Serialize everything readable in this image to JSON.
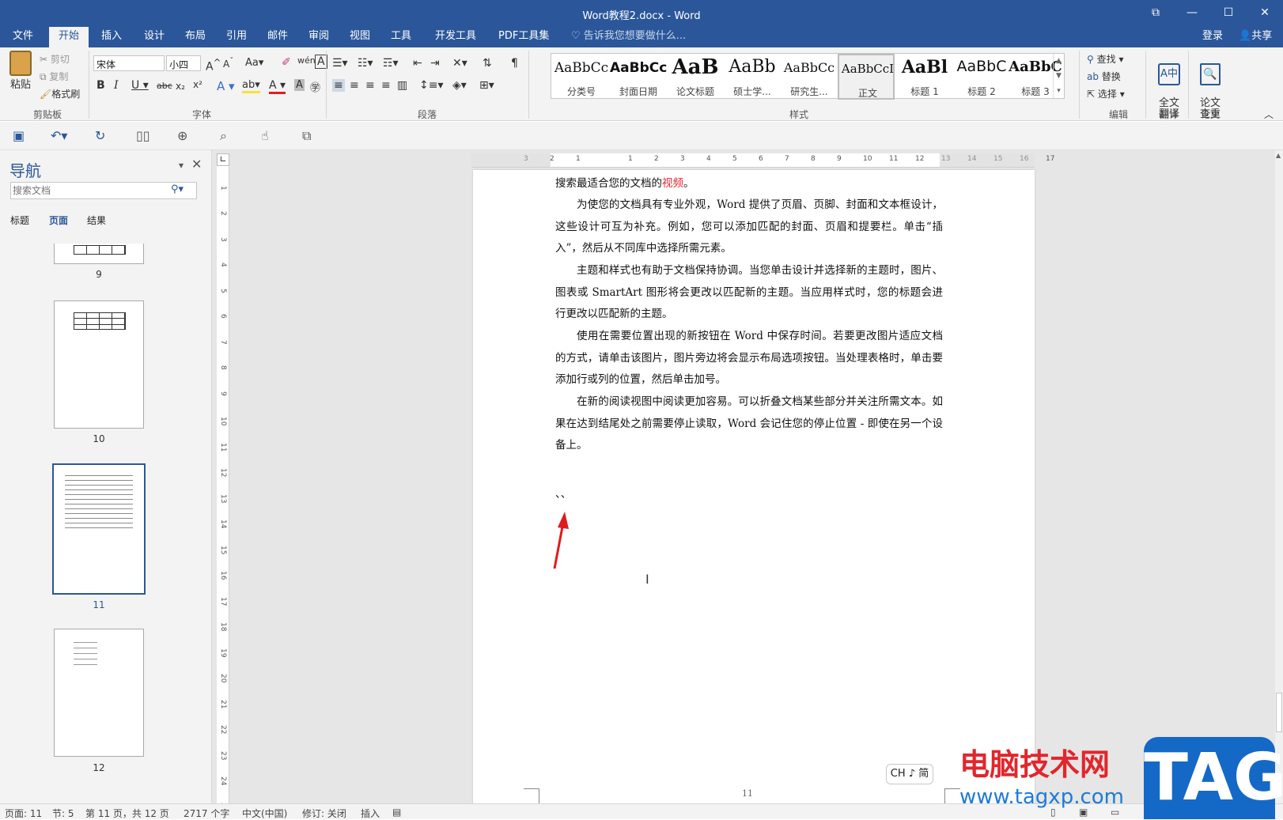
{
  "window": {
    "title": "Word教程2.docx - Word",
    "controls": [
      "⧉",
      "—",
      "☐",
      "✕"
    ]
  },
  "tabs": [
    "文件",
    "开始",
    "插入",
    "设计",
    "布局",
    "引用",
    "邮件",
    "审阅",
    "视图",
    "工具",
    "开发工具",
    "PDF工具集"
  ],
  "active_tab": "开始",
  "tell_me": "告诉我您想要做什么...",
  "account": {
    "login": "登录",
    "share": "共享"
  },
  "ribbon": {
    "clipboard": {
      "paste": "粘贴",
      "cut": "剪切",
      "copy": "复制",
      "format_painter": "格式刷",
      "label": "剪贴板"
    },
    "font": {
      "name": "宋体",
      "size": "小四",
      "label": "字体"
    },
    "paragraph": {
      "label": "段落"
    },
    "styles": {
      "label": "样式",
      "items": [
        {
          "preview": "AaBbCc",
          "name": "分类号"
        },
        {
          "preview": "AaBbCc",
          "name": "封面日期"
        },
        {
          "preview": "AaB",
          "name": "论文标题"
        },
        {
          "preview": "AaBb",
          "name": "硕士学..."
        },
        {
          "preview": "AaBbCc",
          "name": "研究生..."
        },
        {
          "preview": "AaBbCcI",
          "name": "正文"
        },
        {
          "preview": "AaBl",
          "name": "标题 1"
        },
        {
          "preview": "AaBbC",
          "name": "标题 2"
        },
        {
          "preview": "AaBbC",
          "name": "标题 3"
        }
      ],
      "selected": "正文"
    },
    "editing": {
      "find": "查找",
      "replace": "替换",
      "select": "选择",
      "label": "编辑"
    },
    "translate": {
      "full": "全文\n翻译",
      "label": "翻译"
    },
    "paper": {
      "check": "论文\n查重",
      "label": "论文"
    }
  },
  "nav": {
    "title": "导航",
    "search_placeholder": "搜索文档",
    "tabs": [
      "标题",
      "页面",
      "结果"
    ],
    "active_tab": "页面",
    "pages": [
      "9",
      "10",
      "11",
      "12"
    ],
    "selected_page": "11"
  },
  "ruler": {
    "h_ticks": [
      "3",
      "2",
      "1",
      "1",
      "2",
      "3",
      "4",
      "5",
      "6",
      "7",
      "8",
      "9",
      "10",
      "11",
      "12",
      "13",
      "14",
      "15",
      "16",
      "17"
    ]
  },
  "document": {
    "paragraphs": [
      {
        "text": "搜索最适合您的文档的",
        "highlight": "视频",
        "after": "。"
      },
      {
        "text": "为使您的文档具有专业外观，Word 提供了页眉、页脚、封面和文本框设计，这些设计可互为补充。例如，您可以添加匹配的封面、页眉和提要栏。单击“插入”，然后从不同库中选择所需元素。"
      },
      {
        "text": "主题和样式也有助于文档保持协调。当您单击设计并选择新的主题时，图片、图表或 SmartArt 图形将会更改以匹配新的主题。当应用样式时，您的标题会进行更改以匹配新的主题。"
      },
      {
        "text": "使用在需要位置出现的新按钮在 Word 中保存时间。若要更改图片适应文档的方式，请单击该图片，图片旁边将会显示布局选项按钮。当处理表格时，单击要添加行或列的位置，然后单击加号。"
      },
      {
        "text": "在新的阅读视图中阅读更加容易。可以折叠文档某些部分并关注所需文本。如果在达到结尾处之前需要停止读取，Word 会记住您的停止位置 - 即使在另一个设备上。"
      }
    ],
    "marks": "、、",
    "footer_page": "11",
    "ime": "CH ♪ 简"
  },
  "status": {
    "page": "页面: 11",
    "section": "节: 5",
    "pages": "第 11 页，共 12 页",
    "words": "2717 个字",
    "lang": "中文(中国)",
    "track": "修订: 关闭",
    "insert": "插入"
  },
  "watermark": {
    "cn": "电脑技术网",
    "url": "www.tagxp.com",
    "tag": "TAG"
  },
  "colors": {
    "brand": "#2b579a",
    "highlight": "#e2262b",
    "arrow": "#e01b1b"
  }
}
